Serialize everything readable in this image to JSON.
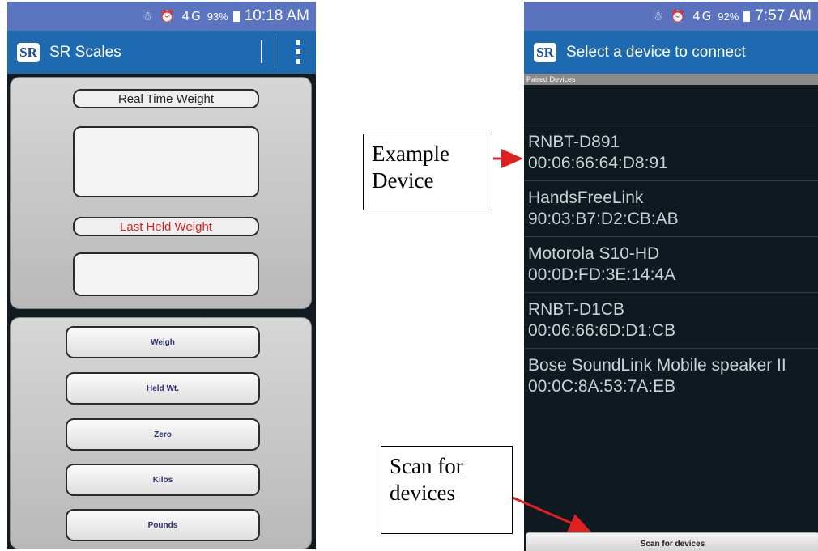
{
  "left_screen": {
    "status_bar": {
      "signal_icons": "☃ ⏰ 4G",
      "battery": "93%",
      "time": "10:18 AM"
    },
    "app_bar": {
      "logo": "SR",
      "title": "SR Scales"
    },
    "realtime_label": "Real Time Weight",
    "last_held_label": "Last Held Weight",
    "buttons": [
      "Weigh",
      "Held Wt.",
      "Zero",
      "Kilos",
      "Pounds"
    ],
    "colors": {
      "app_bar": "#1e6ab0",
      "last_held_text": "#d42323"
    }
  },
  "right_screen": {
    "status_bar": {
      "signal_icons": "☃ ⏰ 4G",
      "battery": "92%",
      "time": "7:57 AM"
    },
    "app_bar": {
      "logo": "SR",
      "title": "Select a device to connect"
    },
    "subheader": "Paired Devices",
    "devices": [
      {
        "name": "RNBT-D891",
        "address": "00:06:66:64:D8:91"
      },
      {
        "name": "HandsFreeLink",
        "address": "90:03:B7:D2:CB:AB"
      },
      {
        "name": "Motorola S10-HD",
        "address": "00:0D:FD:3E:14:4A"
      },
      {
        "name": "RNBT-D1CB",
        "address": "00:06:66:6D:D1:CB"
      },
      {
        "name": "Bose SoundLink Mobile speaker II",
        "address": "00:0C:8A:53:7A:EB"
      }
    ],
    "scan_button": "Scan for devices"
  },
  "annotations": {
    "example_device": "Example Device",
    "scan_for_devices": "Scan for devices",
    "arrow_color": "#e02020"
  }
}
